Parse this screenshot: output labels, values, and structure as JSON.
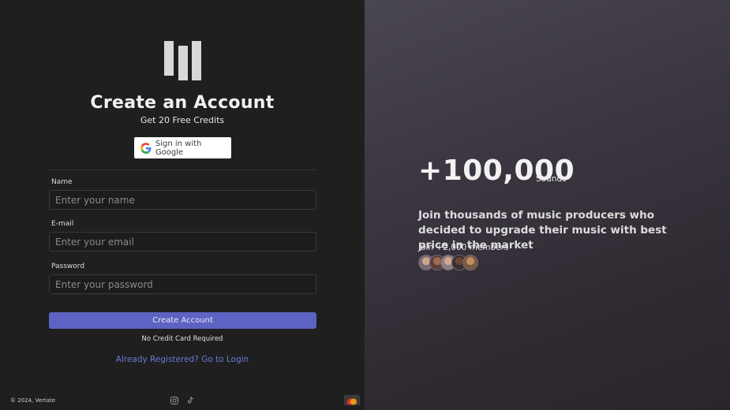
{
  "left": {
    "logo_icon": "vertate-logo-icon",
    "title": "Create an Account",
    "subtitle": "Get 20 Free Credits",
    "google_button": {
      "icon": "google-icon",
      "label": "Sign in with Google"
    },
    "form": {
      "name": {
        "label": "Name",
        "placeholder": "Enter your name",
        "value": ""
      },
      "email": {
        "label": "E-mail",
        "placeholder": "Enter your email",
        "value": ""
      },
      "password": {
        "label": "Password",
        "placeholder": "Enter your password",
        "value": ""
      }
    },
    "submit_label": "Create Account",
    "no_credit_card": "No Credit Card Required",
    "login_link": "Already Registered? Go to Login",
    "footer": {
      "copyright": "© 2024, Vertate",
      "social_icons": [
        "instagram-icon",
        "tiktok-icon"
      ],
      "payment_icon": "mastercard-icon"
    }
  },
  "right": {
    "stat_value": "+100,000",
    "stat_unit": "Sounds",
    "headline": "Join thousands of music producers who decided to upgrade their music with best price in the market",
    "members_text": "Join +2,000 members",
    "avatar_count": 5
  },
  "colors": {
    "left_bg": "#1f1f1f",
    "accent_button": "#5d63c2",
    "link": "#6b78d8",
    "right_bg": "#3a3540"
  }
}
